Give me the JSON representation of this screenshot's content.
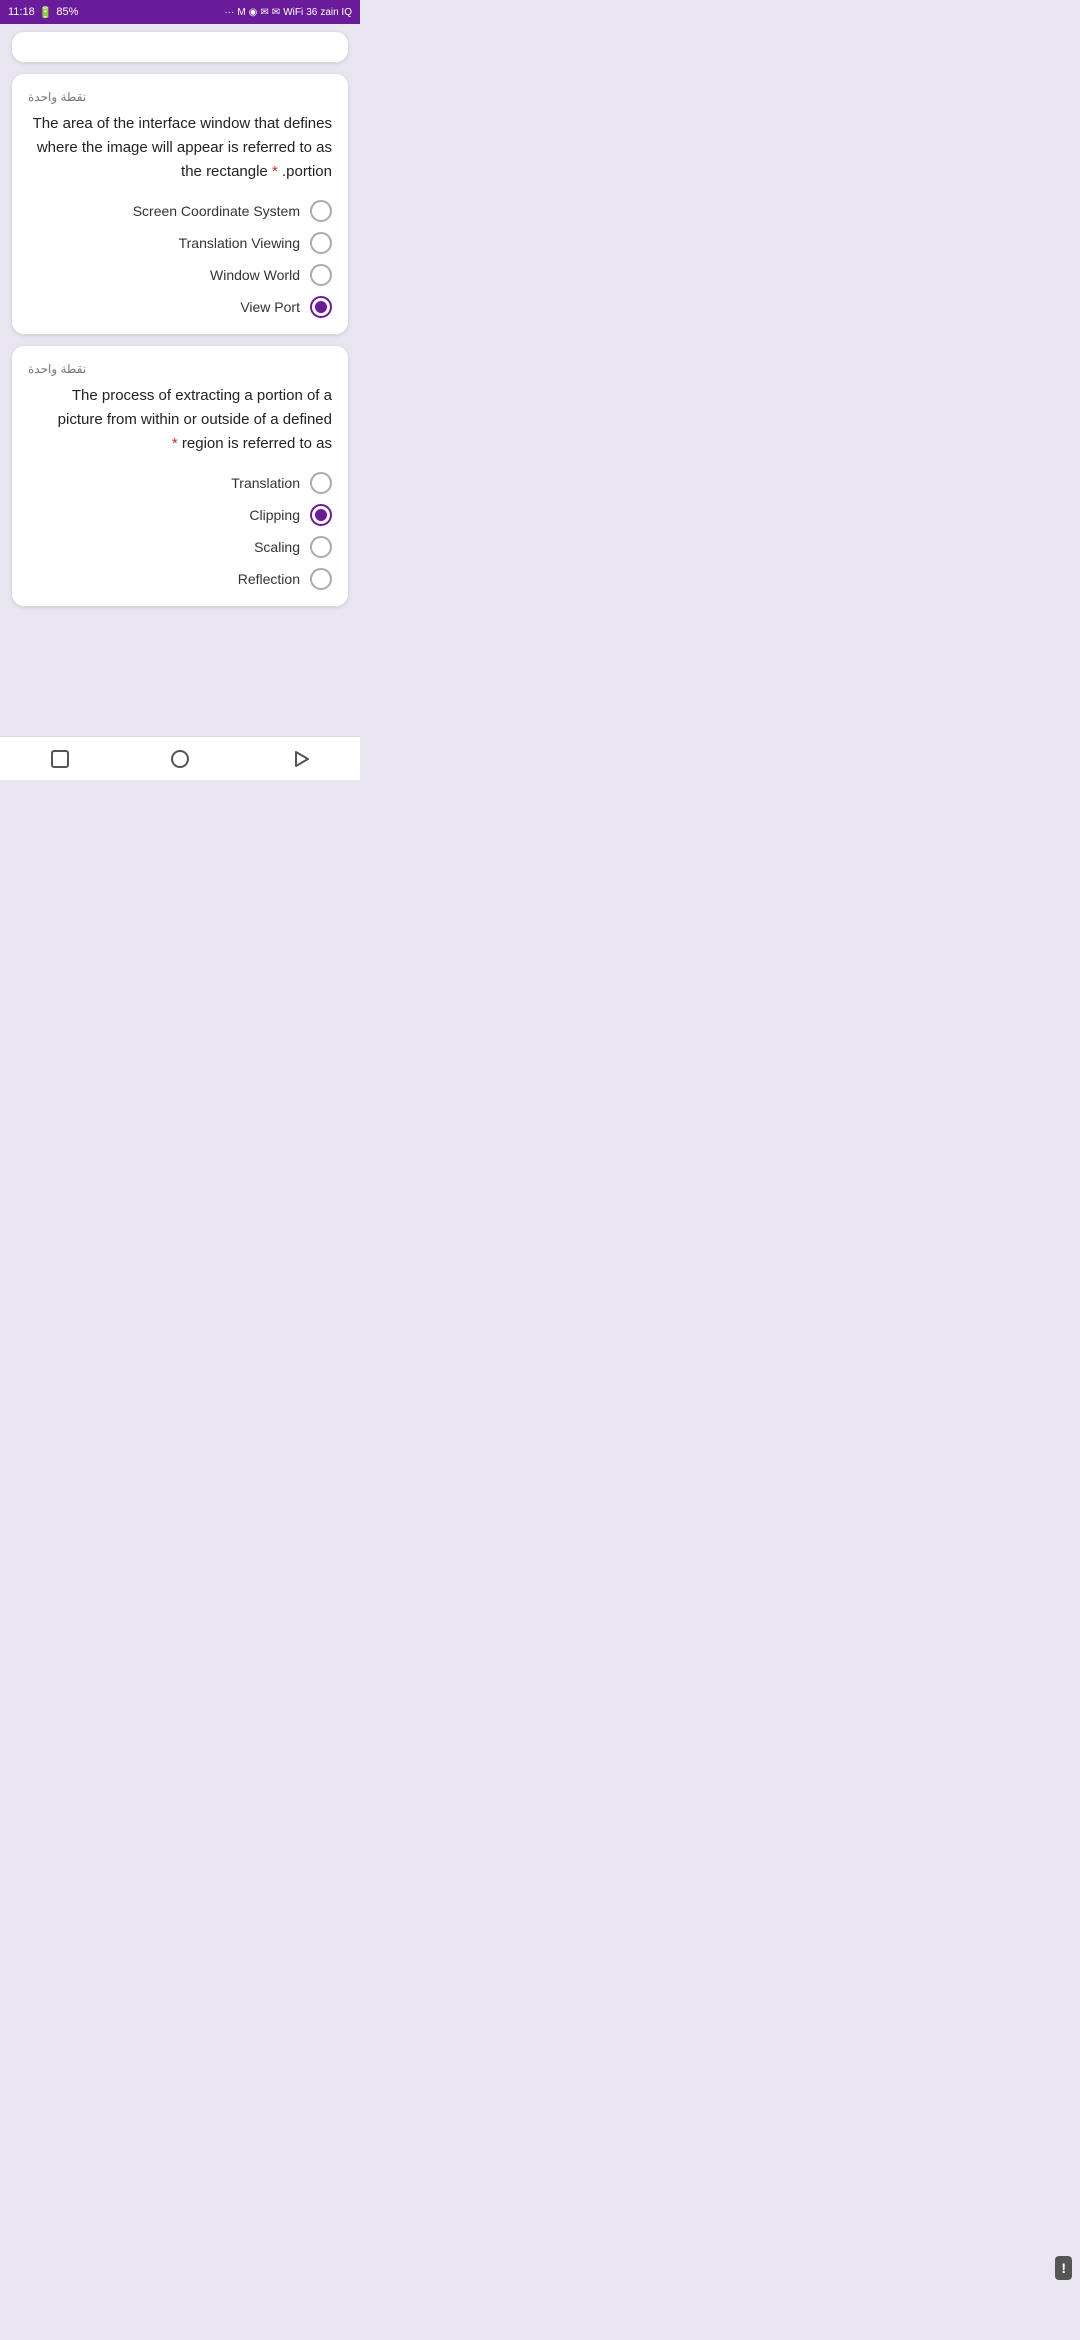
{
  "statusBar": {
    "time": "11:18",
    "battery": "85%",
    "carrier": "zain IQ",
    "network": "3G"
  },
  "questions": [
    {
      "id": "q1",
      "points": "نقطة واحدة",
      "questionText": "The area of the interface window that defines where the image will appear is referred to as the rectangle portion.",
      "asterisk": "*",
      "options": [
        {
          "id": "q1o1",
          "label": "Screen Coordinate System",
          "selected": false
        },
        {
          "id": "q1o2",
          "label": "Translation Viewing",
          "selected": false
        },
        {
          "id": "q1o3",
          "label": "Window World",
          "selected": false
        },
        {
          "id": "q1o4",
          "label": "View Port",
          "selected": true
        }
      ]
    },
    {
      "id": "q2",
      "points": "نقطة واحدة",
      "questionText": "The process of extracting a portion of a picture from within or outside of a defined region is referred to as",
      "asterisk": "*",
      "options": [
        {
          "id": "q2o1",
          "label": "Translation",
          "selected": false
        },
        {
          "id": "q2o2",
          "label": "Clipping",
          "selected": true
        },
        {
          "id": "q2o3",
          "label": "Scaling",
          "selected": false
        },
        {
          "id": "q2o4",
          "label": "Reflection",
          "selected": false
        }
      ]
    }
  ],
  "nav": {
    "square": "□",
    "circle": "○",
    "triangle": "▷"
  },
  "reportBtn": "!"
}
